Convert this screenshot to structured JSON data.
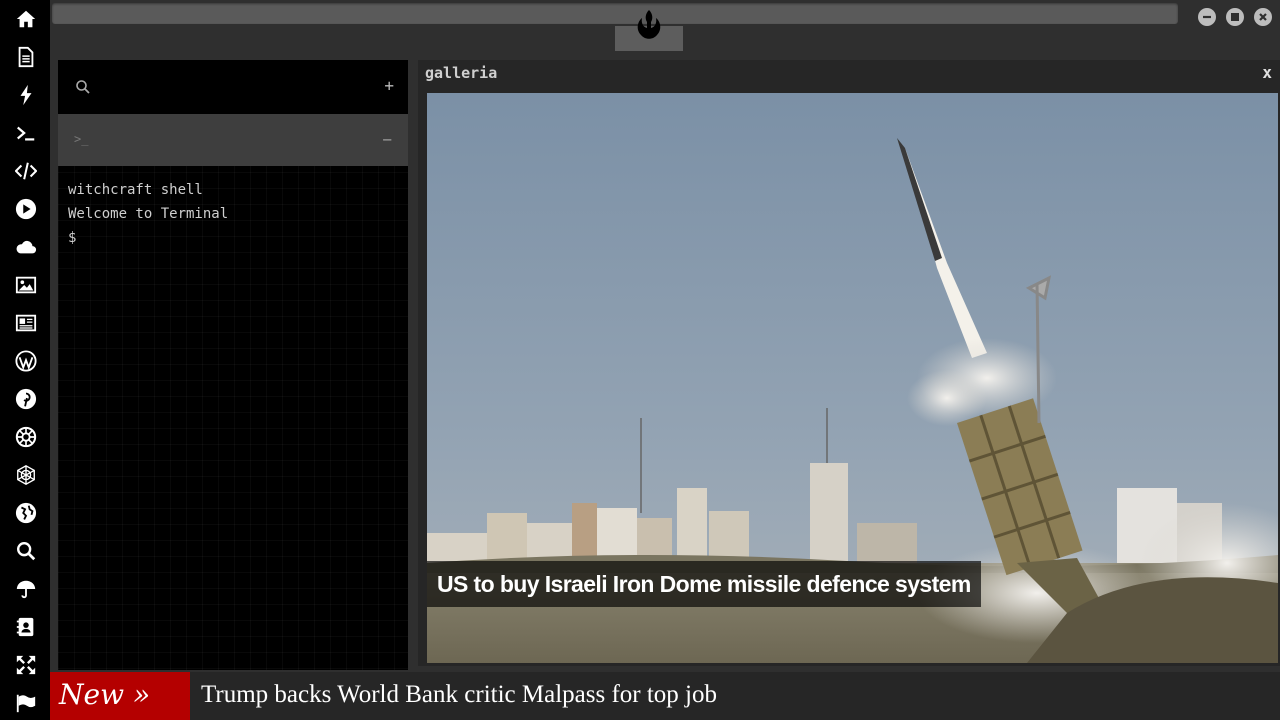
{
  "sidebar": {
    "items": [
      {
        "icon": "home-icon"
      },
      {
        "icon": "document-icon"
      },
      {
        "icon": "lightning-icon"
      },
      {
        "icon": "terminal-icon"
      },
      {
        "icon": "code-icon"
      },
      {
        "icon": "play-icon"
      },
      {
        "icon": "cloud-icon"
      },
      {
        "icon": "image-icon"
      },
      {
        "icon": "newspaper-icon"
      },
      {
        "icon": "wordpress-icon"
      },
      {
        "icon": "pinterest-icon"
      },
      {
        "icon": "galactic-empire-icon"
      },
      {
        "icon": "network-icon"
      },
      {
        "icon": "globe-icon"
      },
      {
        "icon": "search-icon"
      },
      {
        "icon": "umbrella-icon"
      },
      {
        "icon": "contacts-icon"
      },
      {
        "icon": "expand-icon"
      },
      {
        "icon": "flag-icon"
      }
    ]
  },
  "topbar": {
    "logo_icon": "rebel-alliance-icon",
    "window_controls": [
      "minimize-icon",
      "maximize-icon",
      "close-icon"
    ]
  },
  "terminal": {
    "add_label": "+",
    "prompt_glyph": ">_",
    "collapse_label": "−",
    "lines": [
      "witchcraft shell",
      "Welcome to Terminal",
      "$"
    ]
  },
  "galleria": {
    "title": "galleria",
    "close_label": "x",
    "caption": "US to buy Israeli Iron Dome missile defence system"
  },
  "ticker": {
    "badge": "New »",
    "headline": "Trump backs World Bank critic Malpass for top job"
  },
  "colors": {
    "sidebar_bg": "#000000",
    "window_bg": "#2f2f2f",
    "ticker_badge": "#b40000"
  }
}
